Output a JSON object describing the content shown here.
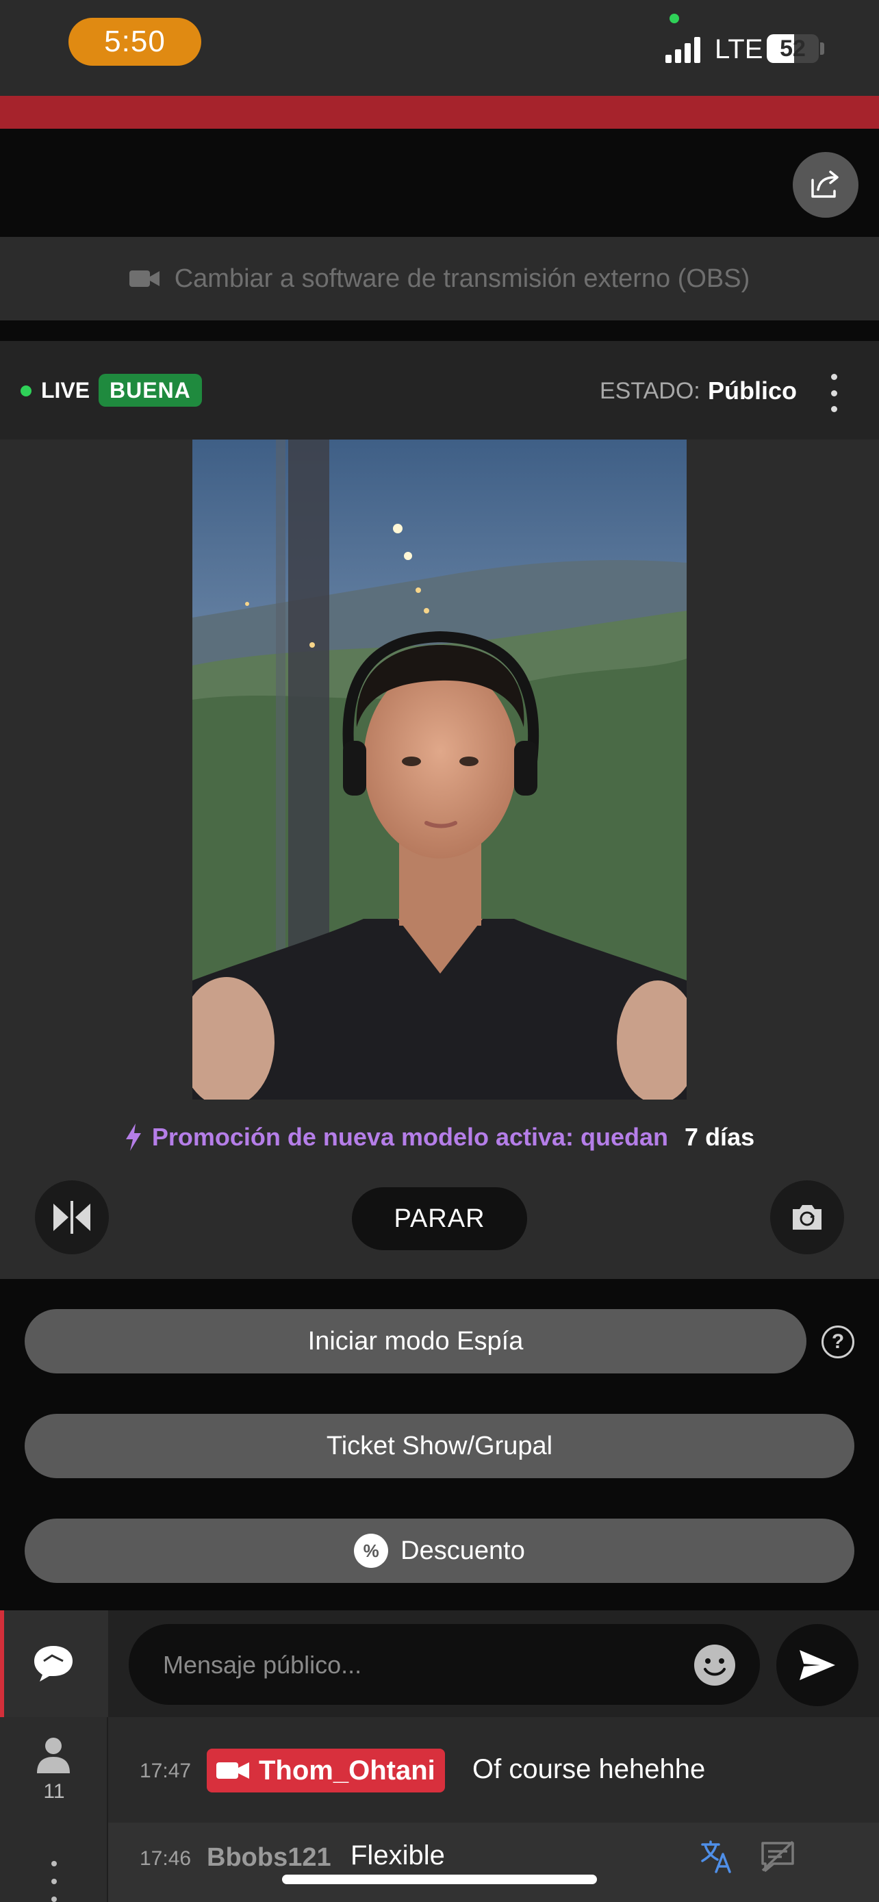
{
  "status_bar": {
    "time": "5:50",
    "network": "LTE",
    "battery": "52",
    "battery_level_percent": 52
  },
  "obs_bar": {
    "label": "Cambiar a software de transmisión externo (OBS)",
    "icon": "video-camera-icon"
  },
  "stream_header": {
    "live_label": "LIVE",
    "quality": "BUENA",
    "estado_label": "ESTADO:",
    "estado_value": "Público"
  },
  "promo": {
    "text": "Promoción de nueva modelo activa: quedan",
    "days": "7 días",
    "color": "#b57ee8"
  },
  "controls": {
    "stop_label": "PARAR",
    "left_icon": "flip-horizontal-icon",
    "right_icon": "camera-switch-icon"
  },
  "actions": {
    "spy_mode": "Iniciar modo Espía",
    "ticket_show": "Ticket Show/Grupal",
    "discount": "Descuento",
    "discount_badge": "%"
  },
  "sidebar": {
    "users_count": "11"
  },
  "composer": {
    "placeholder": "Mensaje público..."
  },
  "messages": [
    {
      "time": "17:47",
      "user": "Thom_Ohtani",
      "text": "Of course hehehhe",
      "highlight_color": "#d8303d"
    },
    {
      "time": "17:46",
      "user": "Bbobs121",
      "text": "Flexible"
    }
  ],
  "colors": {
    "accent_red": "#a6232c",
    "live_green": "#2fd158",
    "quality_green": "#1f8a3e",
    "time_pill": "#e08a12"
  }
}
